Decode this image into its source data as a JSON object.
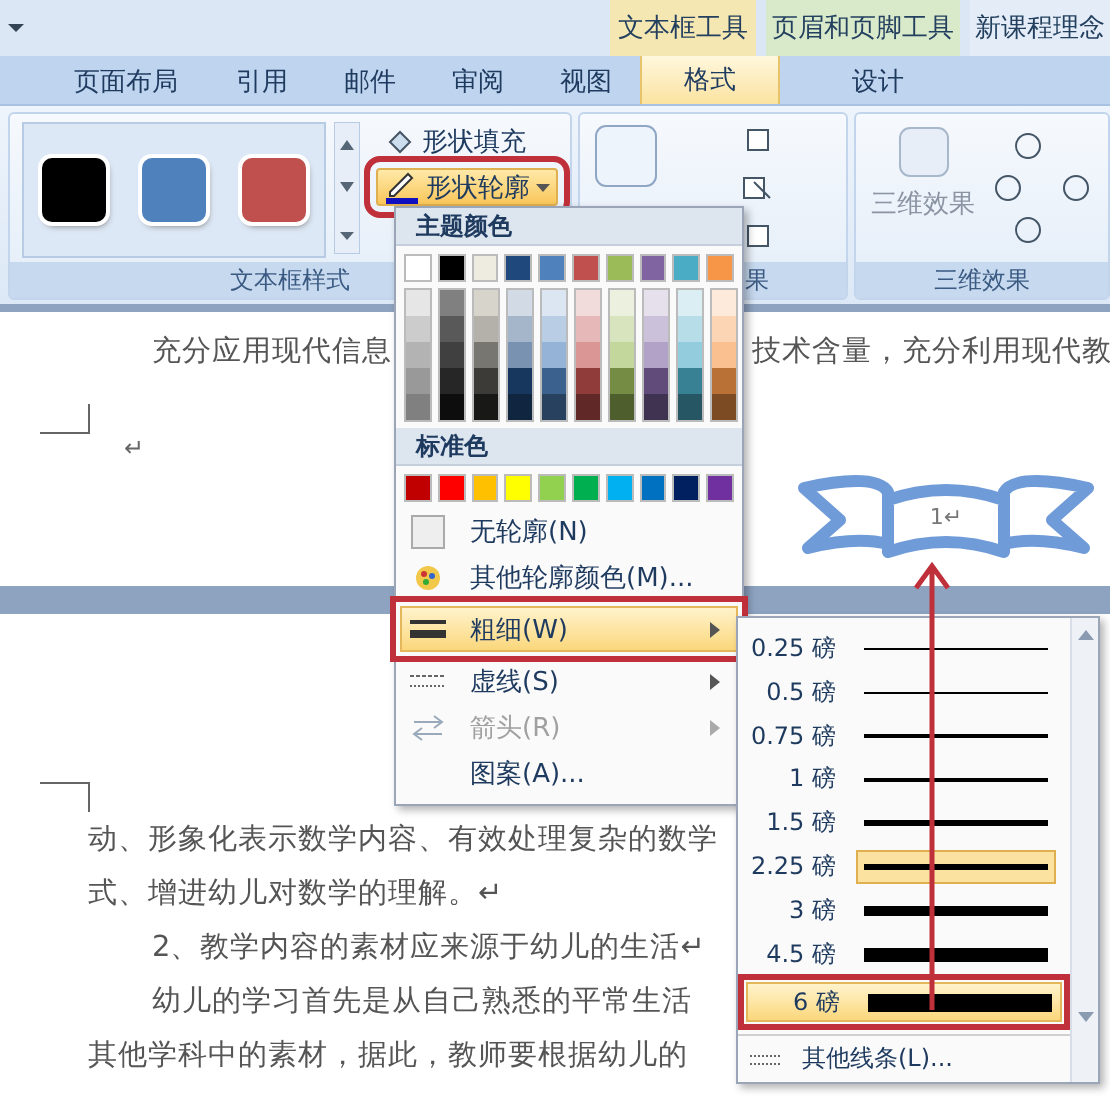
{
  "context_groups": [
    {
      "label": "文本框工具",
      "color": "#f4e7b2"
    },
    {
      "label": "页眉和页脚工具",
      "color": "#d9eacb"
    },
    {
      "label": "新课程理念",
      "color": "#e3ecf7"
    }
  ],
  "tabs": [
    {
      "label": "页面布局",
      "selected": false
    },
    {
      "label": "引用",
      "selected": false
    },
    {
      "label": "邮件",
      "selected": false
    },
    {
      "label": "审阅",
      "selected": false
    },
    {
      "label": "视图",
      "selected": false
    },
    {
      "label": "格式",
      "selected": true
    },
    {
      "label": "设计",
      "selected": false
    }
  ],
  "ribbon": {
    "groups": [
      {
        "label": "文本框样式"
      },
      {
        "label": "果"
      },
      {
        "label": "三维效果"
      }
    ],
    "style_swatches": [
      {
        "color": "#000000"
      },
      {
        "color": "#4f81bd"
      },
      {
        "color": "#c0504d"
      }
    ],
    "shape_fill": "形状填充",
    "shape_outline": "形状轮廓",
    "three_d_button": "三维效果"
  },
  "document": {
    "page1_left": "充分应用现代信息",
    "page1_right": "技术含量，充分利用现代教",
    "page1_mark": "↵",
    "textbox_text": "1↵",
    "page2_lines": [
      {
        "text": "动、形象化表示数学内容、有效处理复杂的数学",
        "indent": false
      },
      {
        "text": "式、增进幼儿对数学的理解。↵",
        "indent": false
      },
      {
        "text": "2、教学内容的素材应来源于幼儿的生活↵",
        "indent": true
      },
      {
        "text": "幼儿的学习首先是从自己熟悉的平常生活",
        "indent": true
      },
      {
        "text": "其他学科中的素材，据此，教师要根据幼儿的",
        "indent": false
      }
    ]
  },
  "outline_menu": {
    "theme_header": "主题颜色",
    "theme_colors": [
      {
        "color": "#ffffff"
      },
      {
        "color": "#000000"
      },
      {
        "color": "#eeece1"
      },
      {
        "color": "#1f497d"
      },
      {
        "color": "#4f81bd"
      },
      {
        "color": "#c0504d"
      },
      {
        "color": "#9bbb59"
      },
      {
        "color": "#8064a2"
      },
      {
        "color": "#4bacc6"
      },
      {
        "color": "#f79646"
      }
    ],
    "standard_header": "标准色",
    "standard_colors": [
      {
        "color": "#c00000"
      },
      {
        "color": "#ff0000"
      },
      {
        "color": "#ffc000"
      },
      {
        "color": "#ffff00"
      },
      {
        "color": "#92d050"
      },
      {
        "color": "#00b050"
      },
      {
        "color": "#00b0f0"
      },
      {
        "color": "#0070c0"
      },
      {
        "color": "#002060"
      },
      {
        "color": "#7030a0"
      }
    ],
    "items": [
      {
        "label": "无轮廓(N)",
        "kind": "none",
        "submenu": false,
        "hovered": false,
        "disabled": false
      },
      {
        "label": "其他轮廓颜色(M)...",
        "kind": "palette",
        "submenu": false,
        "hovered": false,
        "disabled": false
      },
      {
        "label": "粗细(W)",
        "kind": "weight",
        "submenu": true,
        "hovered": true,
        "disabled": false
      },
      {
        "label": "虚线(S)",
        "kind": "dash",
        "submenu": true,
        "hovered": false,
        "disabled": false
      },
      {
        "label": "箭头(R)",
        "kind": "arrow",
        "submenu": true,
        "hovered": false,
        "disabled": true
      },
      {
        "label": "图案(A)...",
        "kind": "pattern",
        "submenu": false,
        "hovered": false,
        "disabled": false
      }
    ]
  },
  "weight_menu": {
    "items": [
      {
        "label": "0.25 磅",
        "kind": "hairline",
        "selected": false,
        "hovered": false
      },
      {
        "label": "0.5 磅",
        "kind": "finest",
        "selected": false,
        "hovered": false
      },
      {
        "label": "0.75 磅",
        "kind": "finer",
        "selected": false,
        "hovered": false
      },
      {
        "label": "1 磅",
        "kind": "fine",
        "selected": false,
        "hovered": false
      },
      {
        "label": "1.5 磅",
        "kind": "light",
        "selected": false,
        "hovered": false
      },
      {
        "label": "2.25 磅",
        "kind": "medium",
        "selected": true,
        "hovered": false
      },
      {
        "label": "3 磅",
        "kind": "bold",
        "selected": false,
        "hovered": false
      },
      {
        "label": "4.5 磅",
        "kind": "heavy",
        "selected": false,
        "hovered": false
      },
      {
        "label": "6 磅",
        "kind": "heaviest",
        "selected": false,
        "hovered": true
      }
    ],
    "more": "其他线条(L)..."
  }
}
